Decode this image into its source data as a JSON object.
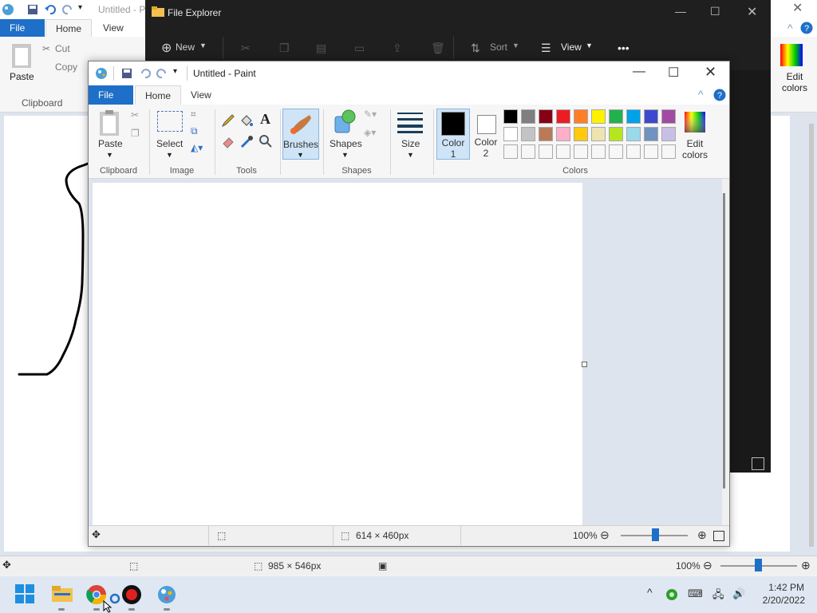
{
  "back_paint": {
    "tabs": {
      "file": "File",
      "home": "Home",
      "view": "View"
    },
    "title_partial": "Untitled - P",
    "ribbon": {
      "paste": "Paste",
      "cut": "Cut",
      "copy": "Copy",
      "clipboard": "Clipboard",
      "edit_colors": "Edit colors"
    },
    "status": {
      "canvas_size": "985 × 546px",
      "zoom": "100%"
    }
  },
  "explorer": {
    "title": "File Explorer",
    "toolbar": {
      "new": "New",
      "sort": "Sort",
      "view": "View",
      "more": "•••"
    }
  },
  "paint": {
    "title": "Untitled - Paint",
    "tabs": {
      "file": "File",
      "home": "Home",
      "view": "View"
    },
    "ribbon": {
      "paste": "Paste",
      "clipboard": "Clipboard",
      "select": "Select",
      "image": "Image",
      "tools": "Tools",
      "brushes": "Brushes",
      "shapes_btn": "Shapes",
      "shapes_group": "Shapes",
      "size": "Size",
      "color1": "Color\n1",
      "color1_a": "Color",
      "color1_b": "1",
      "color2_a": "Color",
      "color2_b": "2",
      "colors": "Colors",
      "edit_a": "Edit",
      "edit_b": "colors"
    },
    "palette": [
      [
        "#000000",
        "#7f7f7f",
        "#880015",
        "#ed1c24",
        "#ff7f27",
        "#fff200",
        "#22b14c",
        "#00a2e8",
        "#3f48cc",
        "#a349a4"
      ],
      [
        "#ffffff",
        "#c3c3c3",
        "#b97a57",
        "#ffaec9",
        "#ffc90e",
        "#efe4b0",
        "#b5e61d",
        "#99d9ea",
        "#7092be",
        "#c8bfe7"
      ],
      [
        "#f7f7f7",
        "#f7f7f7",
        "#f7f7f7",
        "#f7f7f7",
        "#f7f7f7",
        "#f7f7f7",
        "#f7f7f7",
        "#f7f7f7",
        "#f7f7f7",
        "#f7f7f7"
      ]
    ],
    "status": {
      "canvas_size": "614 × 460px",
      "zoom": "100%"
    }
  },
  "taskbar": {
    "time": "1:42 PM",
    "date": "2/20/2022"
  },
  "colors": {
    "accent": "#1e6fc8",
    "explorer_bg": "#1f1f1f"
  }
}
